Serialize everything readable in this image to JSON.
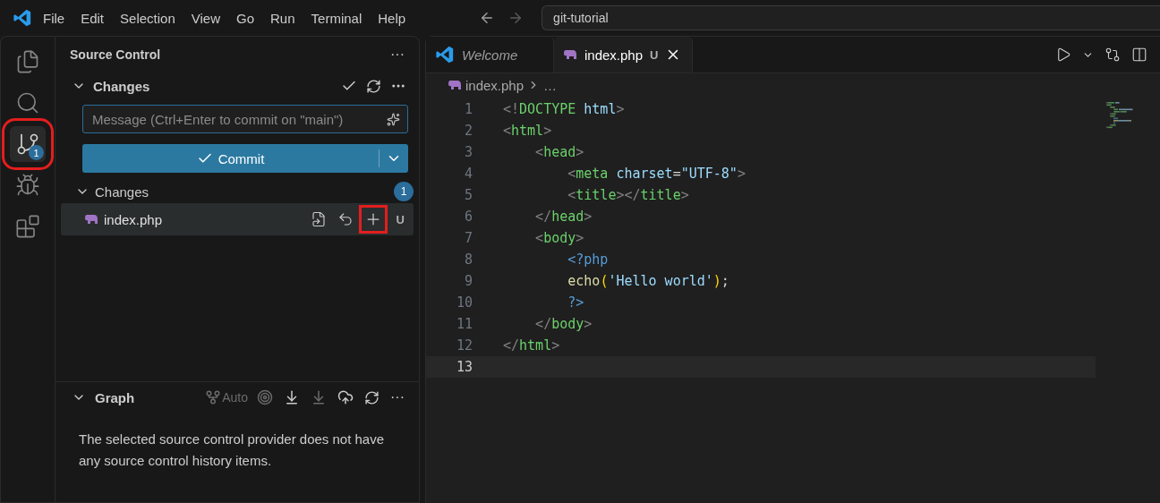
{
  "menu": [
    "File",
    "Edit",
    "Selection",
    "View",
    "Go",
    "Run",
    "Terminal",
    "Help"
  ],
  "command_center": {
    "value": "git-tutorial"
  },
  "activity_bar": [
    {
      "kind": "files",
      "selected": false,
      "highlighted": false
    },
    {
      "kind": "search",
      "selected": false,
      "highlighted": false
    },
    {
      "kind": "scm",
      "selected": true,
      "highlighted": true,
      "badge": "1"
    },
    {
      "kind": "debug",
      "selected": false,
      "highlighted": false
    },
    {
      "kind": "extensions",
      "selected": false,
      "highlighted": false
    }
  ],
  "sidebar": {
    "title": "Source Control",
    "more": "···",
    "changes_header": {
      "label": "Changes",
      "expanded": true
    },
    "message": {
      "placeholder": "Message (Ctrl+Enter to commit on \"main\")"
    },
    "commit_button": "Commit",
    "changes_group": {
      "label": "Changes",
      "expanded": true,
      "count": "1"
    },
    "files": [
      {
        "name": "index.php",
        "status": "U",
        "selected": true,
        "actions": [
          {
            "kind": "open-file",
            "highlighted": false
          },
          {
            "kind": "discard",
            "highlighted": false
          },
          {
            "kind": "stage",
            "highlighted": true
          }
        ]
      }
    ],
    "graph": {
      "label": "Graph",
      "expanded": true,
      "auto": "Auto",
      "more": "···",
      "message": "The selected source control provider does not have any source control history items."
    }
  },
  "tabs": [
    {
      "label": "Welcome",
      "kind": "welcome",
      "selected": false,
      "italic": true
    },
    {
      "label": "index.php",
      "kind": "php",
      "selected": true,
      "italic": false,
      "status": "U"
    }
  ],
  "breadcrumb": [
    "index.php",
    "…"
  ],
  "code": [
    {
      "n": "1",
      "current": false,
      "tokens": [
        {
          "t": "<!",
          "kind": "punct"
        },
        {
          "t": "DOCTYPE",
          "kind": "tag"
        },
        {
          "t": " html",
          "kind": "attr"
        },
        {
          "t": ">",
          "kind": "punct"
        }
      ]
    },
    {
      "n": "2",
      "current": false,
      "tokens": [
        {
          "t": "<",
          "kind": "punct"
        },
        {
          "t": "html",
          "kind": "tag"
        },
        {
          "t": ">",
          "kind": "punct"
        }
      ]
    },
    {
      "n": "3",
      "current": false,
      "tokens": [
        {
          "t": "    <",
          "kind": "punct"
        },
        {
          "t": "head",
          "kind": "tag"
        },
        {
          "t": ">",
          "kind": "punct"
        }
      ]
    },
    {
      "n": "4",
      "current": false,
      "tokens": [
        {
          "t": "        <",
          "kind": "punct"
        },
        {
          "t": "meta",
          "kind": "tag"
        },
        {
          "t": " charset",
          "kind": "attr"
        },
        {
          "t": "=",
          "kind": "plain"
        },
        {
          "t": "\"UTF-8\"",
          "kind": "string"
        },
        {
          "t": ">",
          "kind": "punct"
        }
      ]
    },
    {
      "n": "5",
      "current": false,
      "tokens": [
        {
          "t": "        <",
          "kind": "punct"
        },
        {
          "t": "title",
          "kind": "tag"
        },
        {
          "t": "></",
          "kind": "punct"
        },
        {
          "t": "title",
          "kind": "tag"
        },
        {
          "t": ">",
          "kind": "punct"
        }
      ]
    },
    {
      "n": "6",
      "current": false,
      "tokens": [
        {
          "t": "    </",
          "kind": "punct"
        },
        {
          "t": "head",
          "kind": "tag"
        },
        {
          "t": ">",
          "kind": "punct"
        }
      ]
    },
    {
      "n": "7",
      "current": false,
      "tokens": [
        {
          "t": "    <",
          "kind": "punct"
        },
        {
          "t": "body",
          "kind": "tag"
        },
        {
          "t": ">",
          "kind": "punct"
        }
      ]
    },
    {
      "n": "8",
      "current": false,
      "tokens": [
        {
          "t": "        <?php",
          "kind": "keyword"
        }
      ]
    },
    {
      "n": "9",
      "current": false,
      "tokens": [
        {
          "t": "        echo",
          "kind": "func"
        },
        {
          "t": "(",
          "kind": "paren"
        },
        {
          "t": "'Hello world'",
          "kind": "string"
        },
        {
          "t": ")",
          "kind": "paren"
        },
        {
          "t": ";",
          "kind": "plain"
        }
      ]
    },
    {
      "n": "10",
      "current": false,
      "tokens": [
        {
          "t": "        ?>",
          "kind": "keyword"
        }
      ]
    },
    {
      "n": "11",
      "current": false,
      "tokens": [
        {
          "t": "    </",
          "kind": "punct"
        },
        {
          "t": "body",
          "kind": "tag"
        },
        {
          "t": ">",
          "kind": "punct"
        }
      ]
    },
    {
      "n": "12",
      "current": false,
      "tokens": [
        {
          "t": "</",
          "kind": "punct"
        },
        {
          "t": "html",
          "kind": "tag"
        },
        {
          "t": ">",
          "kind": "punct"
        }
      ]
    },
    {
      "n": "13",
      "current": true
    }
  ]
}
